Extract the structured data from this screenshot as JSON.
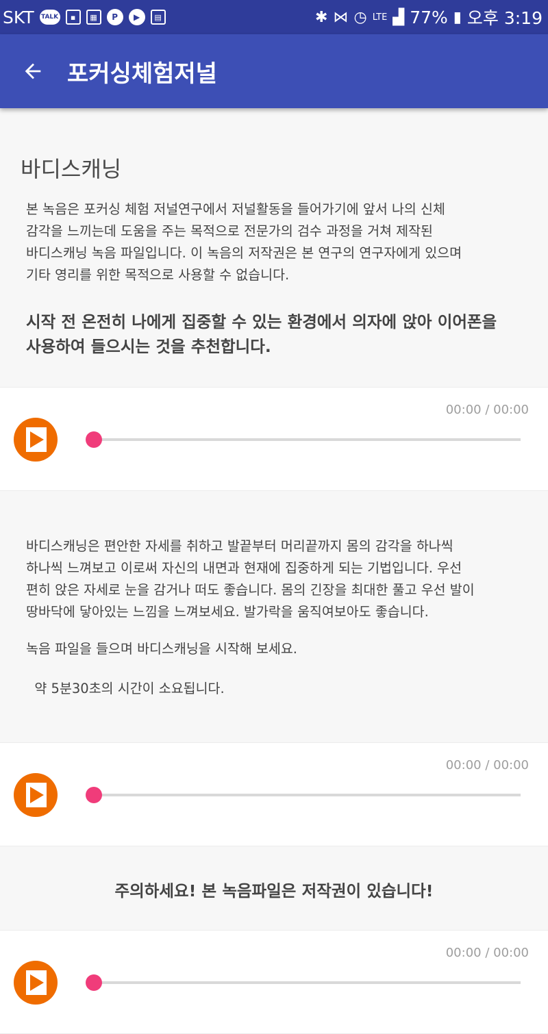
{
  "status_bar": {
    "carrier": "SKT",
    "talk_label": "TALK",
    "battery": "77%",
    "time": "오후 3:19",
    "lte": "LTE"
  },
  "app_bar": {
    "title": "포커싱체험저널"
  },
  "content": {
    "section_title": "바디스캐닝",
    "intro": " 본 녹음은 포커싱 체험 저널연구에서 저널활동을 들어가기에 앞서 나의 신체\n감각을 느끼는데 도움을 주는 목적으로 전문가의 검수 과정을 거쳐 제작된\n바디스캐닝 녹음 파일입니다. 이 녹음의 저작권은 본 연구의 연구자에게 있으며\n기타 영리를 위한 목적으로 사용할 수 없습니다.",
    "recommendation": "시작 전 온전히 나에게 집중할 수 있는 환경에서 의자에 앉아 이어폰을\n사용하여 들으시는 것을 추천합니다.",
    "description": "바디스캐닝은 편안한 자세를 취하고 발끝부터 머리끝까지 몸의 감각을 하나씩\n하나씩 느껴보고 이로써 자신의 내면과 현재에 집중하게 되는 기법입니다. 우선\n편히 앉은 자세로 눈을 감거나 떠도 좋습니다. 몸의 긴장을 최대한 풀고 우선 발이\n땅바닥에 닿아있는 느낌을 느껴보세요. 발가락을 움직여보아도 좋습니다.",
    "instruction": "녹음 파일을 들으며 바디스캐닝을 시작해 보세요.",
    "duration": "  약 5분30초의 시간이 소요됩니다.",
    "warning": "주의하세요! 본 녹음파일은 저작권이 있습니다!"
  },
  "players": [
    {
      "time": "00:00 / 00:00",
      "progress": 0
    },
    {
      "time": "00:00 / 00:00",
      "progress": 0
    },
    {
      "time": "00:00 / 00:00",
      "progress": 0
    }
  ],
  "colors": {
    "status_bar": "#2f3c9a",
    "app_bar": "#3d4fb5",
    "play_button": "#ef6c00",
    "seek_thumb": "#f03c7a"
  },
  "icons": {
    "back": "arrow-back-icon",
    "play": "play-icon"
  }
}
